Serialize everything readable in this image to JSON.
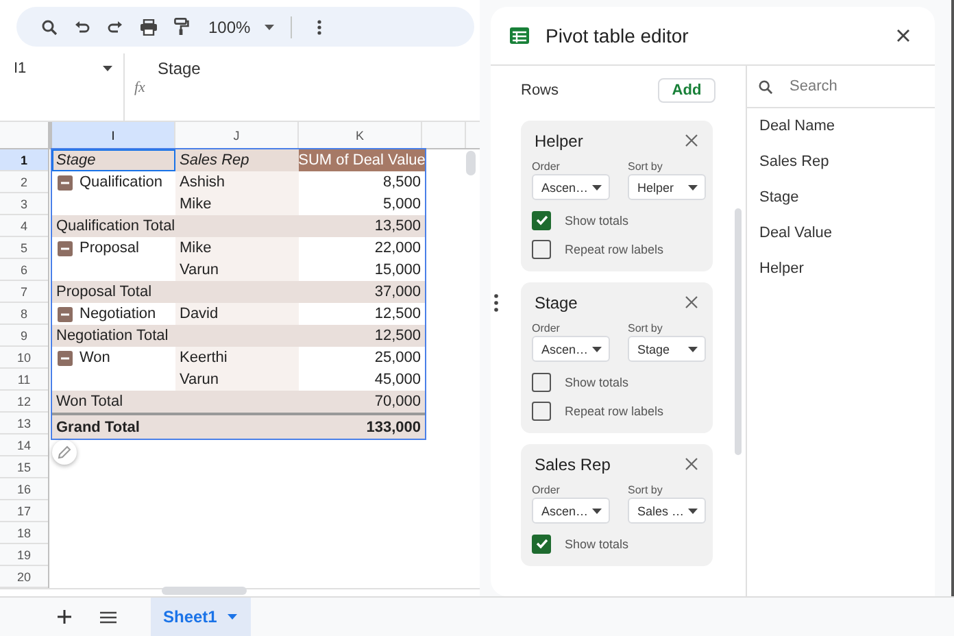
{
  "toolbar": {
    "zoom": "100%"
  },
  "name_box": "I1",
  "formula_icon": "fx",
  "formula": "Stage",
  "columns": [
    {
      "label": "I",
      "selected": true
    },
    {
      "label": "J",
      "selected": false
    },
    {
      "label": "K",
      "selected": false
    }
  ],
  "row_numbers": [
    "1",
    "2",
    "3",
    "4",
    "5",
    "6",
    "7",
    "8",
    "9",
    "10",
    "11",
    "12",
    "13",
    "14",
    "15",
    "16",
    "17",
    "18",
    "19",
    "20"
  ],
  "rows": [
    {
      "kind": "header",
      "stage": "Stage",
      "rep": "Sales Rep",
      "value": "SUM of Deal Value",
      "selected": true
    },
    {
      "kind": "item",
      "stage": "Qualification",
      "expanded": true,
      "rep": "Ashish",
      "value": "8,500"
    },
    {
      "kind": "item",
      "rep": "Mike",
      "value": "5,000"
    },
    {
      "kind": "subtotal",
      "stage": "Qualification Total",
      "value": "13,500"
    },
    {
      "kind": "item",
      "stage": "Proposal",
      "expanded": true,
      "rep": "Mike",
      "value": "22,000"
    },
    {
      "kind": "item",
      "rep": "Varun",
      "value": "15,000"
    },
    {
      "kind": "subtotal",
      "stage": "Proposal Total",
      "value": "37,000"
    },
    {
      "kind": "item",
      "stage": "Negotiation",
      "expanded": true,
      "rep": "David",
      "value": "12,500"
    },
    {
      "kind": "subtotal",
      "stage": "Negotiation Total",
      "value": "12,500"
    },
    {
      "kind": "item",
      "stage": "Won",
      "expanded": true,
      "rep": "Keerthi",
      "value": "25,000"
    },
    {
      "kind": "item",
      "rep": "Varun",
      "value": "45,000"
    },
    {
      "kind": "subtotal",
      "stage": "Won Total",
      "value": "70,000"
    },
    {
      "kind": "grand",
      "stage": "Grand Total",
      "value": "133,000"
    }
  ],
  "sheet_tabs": [
    {
      "label": "Sheet1",
      "selected": true
    }
  ],
  "editor": {
    "title": "Pivot table editor",
    "section": "Rows",
    "add_button": "Add",
    "cards": [
      {
        "title": "Helper",
        "order_label": "Order",
        "order": "Ascen…",
        "sort_label": "Sort by",
        "sort": "Helper",
        "options": [
          {
            "label": "Show totals",
            "checked": true
          },
          {
            "label": "Repeat row labels",
            "checked": false
          }
        ]
      },
      {
        "title": "Stage",
        "order_label": "Order",
        "order": "Ascen…",
        "sort_label": "Sort by",
        "sort": "Stage",
        "options": [
          {
            "label": "Show totals",
            "checked": false
          },
          {
            "label": "Repeat row labels",
            "checked": false
          }
        ]
      },
      {
        "title": "Sales Rep",
        "order_label": "Order",
        "order": "Ascen…",
        "sort_label": "Sort by",
        "sort": "Sales …",
        "options": [
          {
            "label": "Show totals",
            "checked": true
          }
        ]
      }
    ],
    "search": {
      "placeholder": "Search"
    },
    "fields": [
      "Deal Name",
      "Sales Rep",
      "Stage",
      "Deal Value",
      "Helper"
    ]
  }
}
